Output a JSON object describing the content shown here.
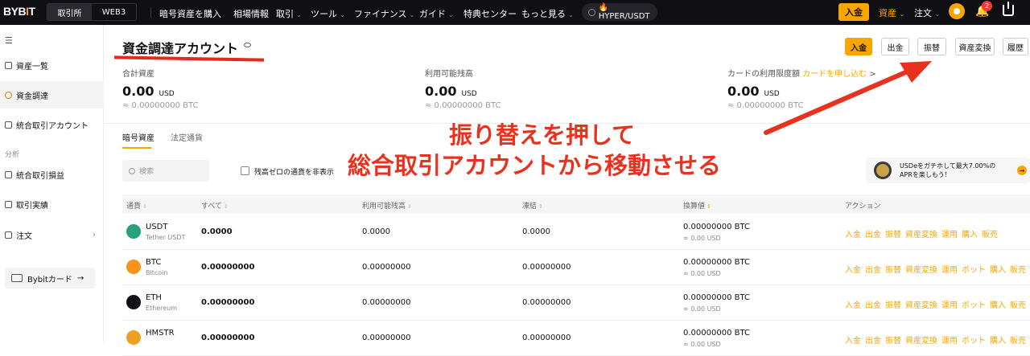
{
  "colors": {
    "accent": "#f7a600",
    "topbar": "#101014",
    "annotation": "#e8321f",
    "negative_badge": "#f03a36"
  },
  "topbar": {
    "logo_text": "BYB",
    "logo_dot": "I",
    "logo_end": "T",
    "seg_exchange": "取引所",
    "seg_web3": "WEB3",
    "nav": [
      "暗号資産を購入",
      "相場情報",
      "取引",
      "ツール",
      "ファイナンス",
      "ガイド",
      "特典センター",
      "もっと見る"
    ],
    "search_text": "🔥HYPER/USDT",
    "deposit": "入金",
    "assets": "資産",
    "order": "注文",
    "notification_count": "2",
    "icons": [
      "search-icon",
      "avatar-icon",
      "bell-icon",
      "download-icon"
    ]
  },
  "sidebar": {
    "items": [
      {
        "label": "資産一覧"
      },
      {
        "label": "資金調達"
      },
      {
        "label": "統合取引アカウント"
      }
    ],
    "section_analysis": "分析",
    "analysis_items": [
      {
        "label": "統合取引損益"
      },
      {
        "label": "取引実績"
      },
      {
        "label": "注文"
      }
    ],
    "card_button": "Bybitカード",
    "card_arrow": "→"
  },
  "main": {
    "title": "資金調達アカウント",
    "buttons": {
      "deposit": "入金",
      "withdraw": "出金",
      "transfer": "振替",
      "convert": "資産変換",
      "history": "履歴"
    },
    "stats": [
      {
        "label": "合計資産",
        "value": "0.00",
        "unit": "USD",
        "sub": "≈ 0.00000000 BTC"
      },
      {
        "label": "利用可能残高",
        "value": "0.00",
        "unit": "USD",
        "sub": "≈ 0.00000000 BTC"
      },
      {
        "label": "カードの利用限度額",
        "link": "カードを申し込む",
        "link_arrow": ">",
        "value": "0.00",
        "unit": "USD",
        "sub": "≈ 0.00000000 BTC"
      }
    ],
    "tabs": [
      "暗号資産",
      "法定通貨"
    ],
    "search_placeholder": "検索",
    "hide_zero_label": "残高ゼロの通貨を非表示",
    "promo": {
      "text": "USDeをガチホして最大7.00%のAPRを楽しもう！",
      "arrow": "→"
    },
    "table": {
      "headers": [
        "通貨",
        "すべて",
        "利用可能残高",
        "凍結",
        "換算値",
        "アクション"
      ],
      "rows": [
        {
          "symbol": "USDT",
          "name": "Tether USDT",
          "total": "0.0000",
          "available": "0.0000",
          "frozen": "0.0000",
          "btc": "0.00000000 BTC",
          "usd": "≈ 0.00 USD",
          "actions": [
            "入金",
            "出金",
            "振替",
            "資産変換",
            "運用",
            "購入",
            "販売"
          ],
          "icon_color": "#26a17b"
        },
        {
          "symbol": "BTC",
          "name": "Bitcoin",
          "total": "0.00000000",
          "available": "0.00000000",
          "frozen": "0.00000000",
          "btc": "0.00000000 BTC",
          "usd": "≈ 0.00 USD",
          "actions": [
            "入金",
            "出金",
            "振替",
            "資産変換",
            "運用",
            "ボット",
            "購入",
            "販売"
          ],
          "icon_color": "#f7931a"
        },
        {
          "symbol": "ETH",
          "name": "Ethereum",
          "total": "0.00000000",
          "available": "0.00000000",
          "frozen": "0.00000000",
          "btc": "0.00000000 BTC",
          "usd": "≈ 0.00 USD",
          "actions": [
            "入金",
            "出金",
            "振替",
            "資産変換",
            "運用",
            "ボット",
            "購入",
            "販売"
          ],
          "icon_color": "#121214"
        },
        {
          "symbol": "HMSTR",
          "name": "",
          "total": "0.00000000",
          "available": "0.00000000",
          "frozen": "0.00000000",
          "btc": "0.00000000 BTC",
          "usd": "≈ 0.00 USD",
          "actions": [
            "入金",
            "出金",
            "振替",
            "資産変換",
            "運用",
            "ボット",
            "購入",
            "販売"
          ],
          "icon_color": "#f0a020"
        }
      ]
    }
  },
  "annotation": {
    "line1": "振り替えを押して",
    "line2": "総合取引アカウントから移動させる"
  }
}
